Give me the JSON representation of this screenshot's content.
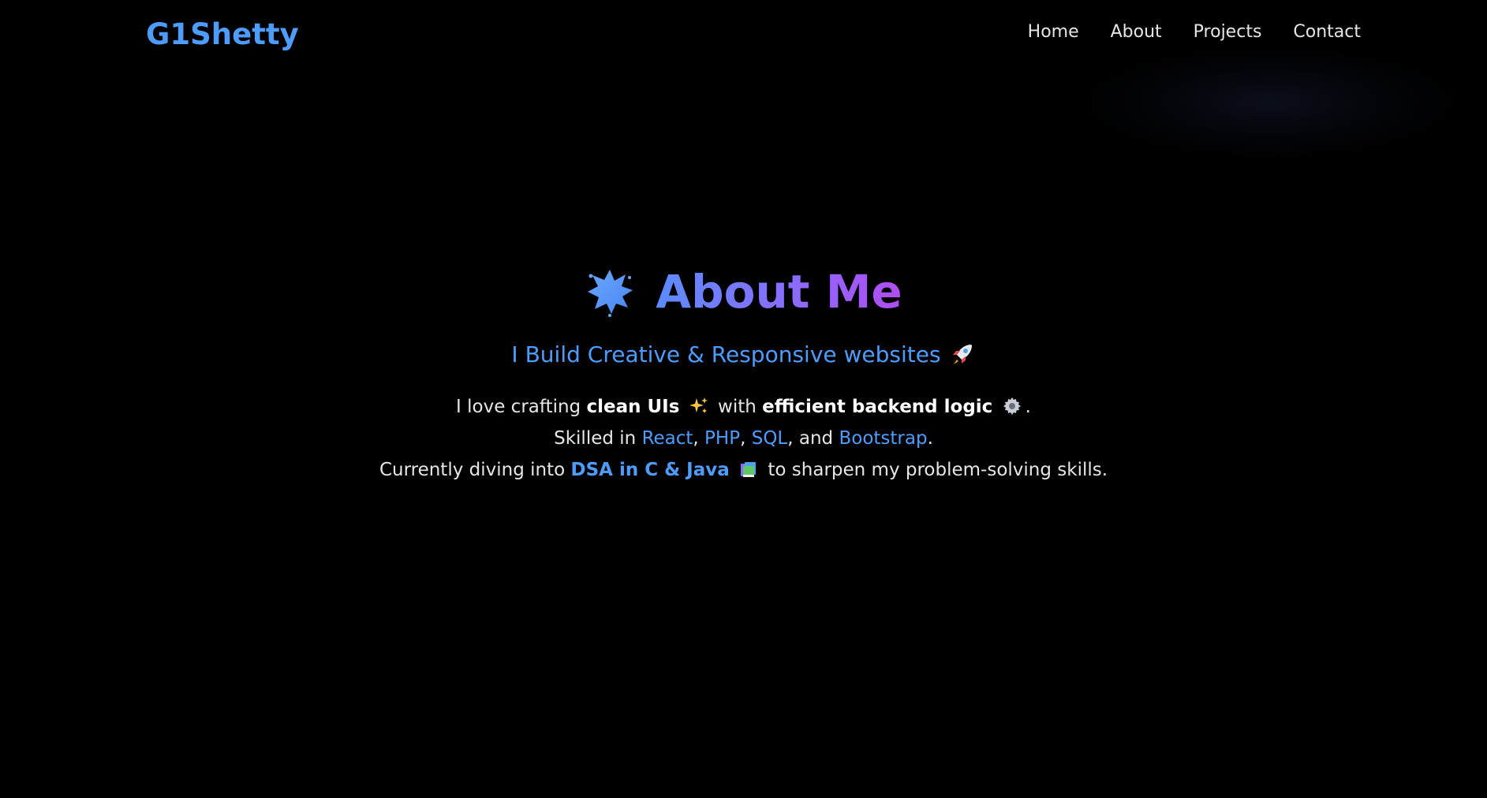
{
  "nav": {
    "logo": "G1Shetty",
    "links": [
      "Home",
      "About",
      "Projects",
      "Contact"
    ]
  },
  "about": {
    "title": "About Me",
    "title_icon": "star-splat-icon",
    "subtitle": "I Build Creative & Responsive websites",
    "subtitle_icon": "rocket-icon",
    "line1": {
      "pre": "I love crafting ",
      "strong1": "clean UIs",
      "icon1": "sparkles-icon",
      "mid": " with ",
      "strong2": "efficient backend logic",
      "icon2": "gear-icon",
      "post": "."
    },
    "line2": {
      "pre": "Skilled in ",
      "tech1": "React",
      "sep1": ", ",
      "tech2": "PHP",
      "sep2": ", ",
      "tech3": "SQL",
      "sep3": ", and ",
      "tech4": "Bootstrap",
      "post": "."
    },
    "line3": {
      "pre": "Currently diving into ",
      "highlight": "DSA in C & Java",
      "icon": "books-icon",
      "post": " to sharpen my problem-solving skills."
    }
  },
  "colors": {
    "background": "#000000",
    "accent": "#4f9cff",
    "gradient_end": "#b04df0",
    "text": "#e6e6e6"
  }
}
